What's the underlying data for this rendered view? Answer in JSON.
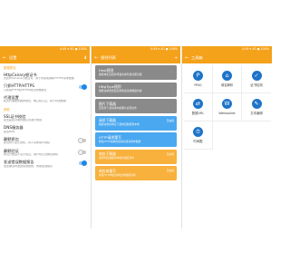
{
  "statusbar": {
    "left": "",
    "right": "4:49 ▾ 4G ◼ 100%"
  },
  "panel1": {
    "appbar": {
      "back": "←",
      "title": "设置",
      "action": "⬇"
    },
    "sections": [
      {
        "title": "数据抓包"
      },
      {
        "title": "其他"
      }
    ],
    "rows": [
      {
        "title": "HttpCanary根证书",
        "subtitle": "安装HttpCanary根证书，用于抓取和解析HTTPS请求数据"
      },
      {
        "title": "只抓HTTP/HTTPS",
        "subtitle": "只抓取HTTP和HTTPS协议的数据包"
      },
      {
        "title": "代理设置",
        "subtitle": "配置代理服务器的地址、端口和认证，用于转发数据"
      },
      {
        "title": "SSL证书校验",
        "subtitle": "配置是否对服务器证书进行校验"
      },
      {
        "title": "DNS服务器",
        "subtitle": "配置DNS"
      },
      {
        "title": "静默抓包",
        "subtitle": "抓包时不显示通知，并不请求用户授权"
      },
      {
        "title": "静默验证",
        "subtitle": "抓包开始后不显示验证，用户将无法看到通知"
      },
      {
        "title": "发送错误数据报告",
        "subtitle": "发生崩溃时发送错误报告，帮助改进程序"
      }
    ]
  },
  "panel2": {
    "appbar": {
      "back": "←",
      "title": "规则列表",
      "action": "+"
    },
    "cards": [
      {
        "title": "Host规则",
        "subtitle": "根据域名匹配并转发请求到目标服务器",
        "tag": ""
      },
      {
        "title": "HttpType规则",
        "subtitle": "根据请求类型匹配并修改请求数据内容",
        "tag": ""
      },
      {
        "title": "图片下载器",
        "subtitle": "匹配并下载请求中的图片资源文件",
        "tag": ""
      },
      {
        "title": "请求下载器",
        "subtitle": "根据请求的地址下载响应数据到本地",
        "tag": "已启用"
      },
      {
        "title": "HTTP请求重写",
        "subtitle": "修改HTTP请求的请求头和请求体数据",
        "tag": ""
      },
      {
        "title": "响应下载器",
        "subtitle": "保存响应数据到本地存储目录中",
        "tag": "已启用"
      },
      {
        "title": "响应体重写",
        "subtitle": "修改HTTP响应的响应体数据内容",
        "tag": "已启用"
      }
    ]
  },
  "panel3": {
    "appbar": {
      "back": "←",
      "title": "工具箱",
      "action": ""
    },
    "tools": [
      {
        "label": "PING",
        "icon": "ping-icon",
        "glyph": "P"
      },
      {
        "label": "域名解析",
        "icon": "dns-icon",
        "glyph": "⌂"
      },
      {
        "label": "证书检测",
        "icon": "certificate-icon",
        "glyph": "✓"
      },
      {
        "label": "数据URL",
        "icon": "url-icon",
        "glyph": "⇄"
      },
      {
        "label": "Websocket",
        "icon": "websocket-icon",
        "glyph": "W"
      },
      {
        "label": "文本编辑",
        "icon": "text-edit-icon",
        "glyph": "✎"
      },
      {
        "label": "时间戳",
        "icon": "timestamp-icon",
        "glyph": "⏱"
      }
    ]
  }
}
